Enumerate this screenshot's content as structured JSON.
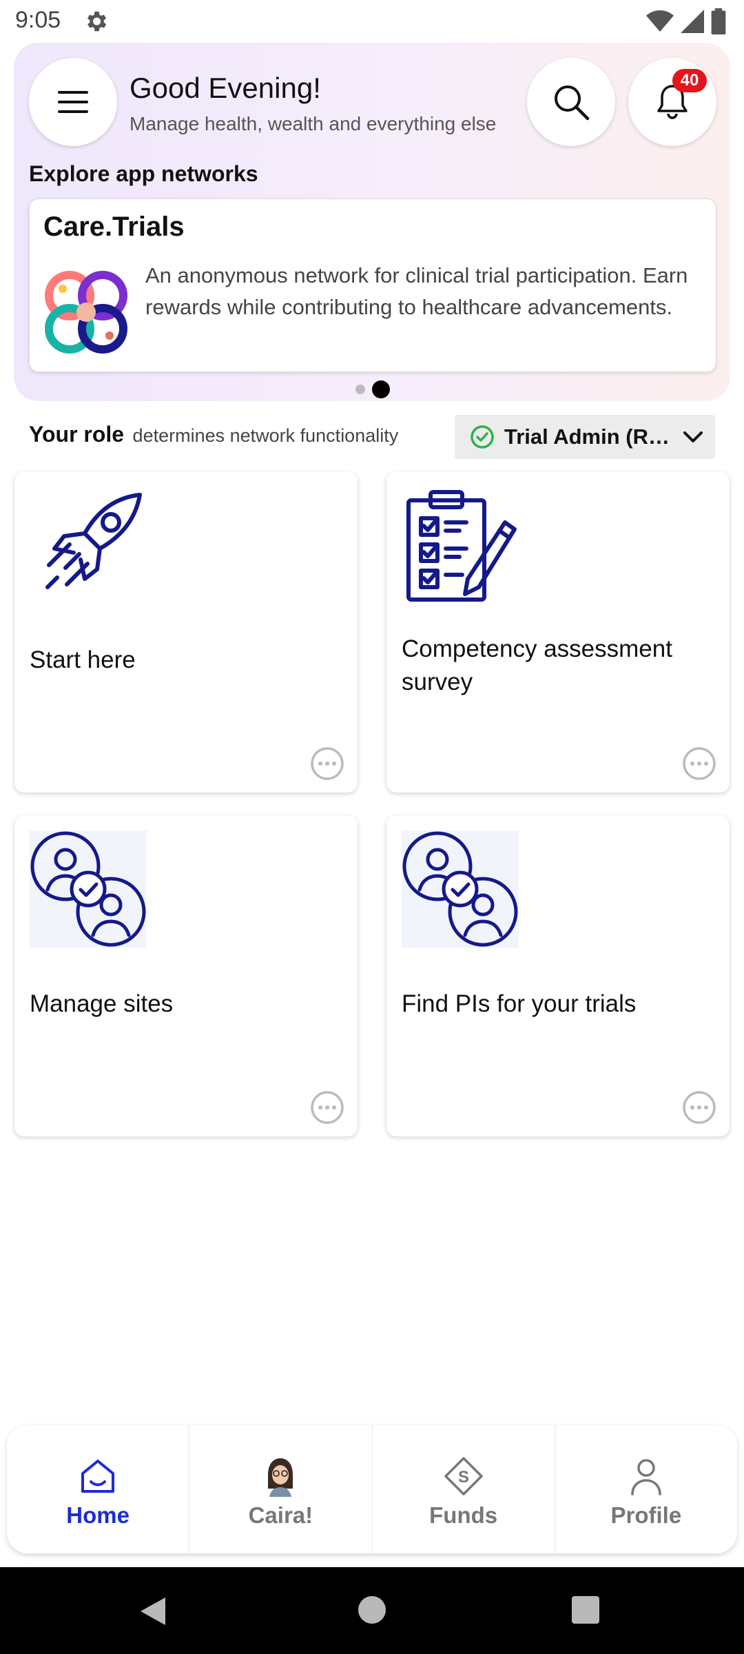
{
  "status_bar": {
    "time": "9:05"
  },
  "header": {
    "greeting": "Good Evening!",
    "subtitle": "Manage health, wealth and everything else",
    "notification_count": "40"
  },
  "networks": {
    "section_title": "Explore app networks",
    "card": {
      "title": "Care.Trials",
      "description": "An anonymous network for clinical trial participation. Earn rewards while contributing to healthcare advancements."
    },
    "pager": {
      "total": 2,
      "active": 2
    }
  },
  "role": {
    "label_strong": "Your role",
    "label_rest": "determines network functionality",
    "selected": "Trial Admin (R…"
  },
  "tiles": [
    {
      "label": "Start here",
      "icon": "rocket-icon"
    },
    {
      "label": "Competency assessment survey",
      "icon": "clipboard-checklist-icon"
    },
    {
      "label": "Manage sites",
      "icon": "users-verified-icon"
    },
    {
      "label": "Find PIs for your trials",
      "icon": "users-verified-icon"
    }
  ],
  "bottom_nav": {
    "items": [
      {
        "label": "Home",
        "icon": "home-icon",
        "active": true
      },
      {
        "label": "Caira!",
        "icon": "avatar-icon",
        "active": false
      },
      {
        "label": "Funds",
        "icon": "funds-icon",
        "active": false
      },
      {
        "label": "Profile",
        "icon": "profile-icon",
        "active": false
      }
    ]
  },
  "colors": {
    "accent": "#1d2bd6",
    "icon_navy": "#141a8a",
    "badge": "#e8141c",
    "check_green": "#2db34a"
  }
}
